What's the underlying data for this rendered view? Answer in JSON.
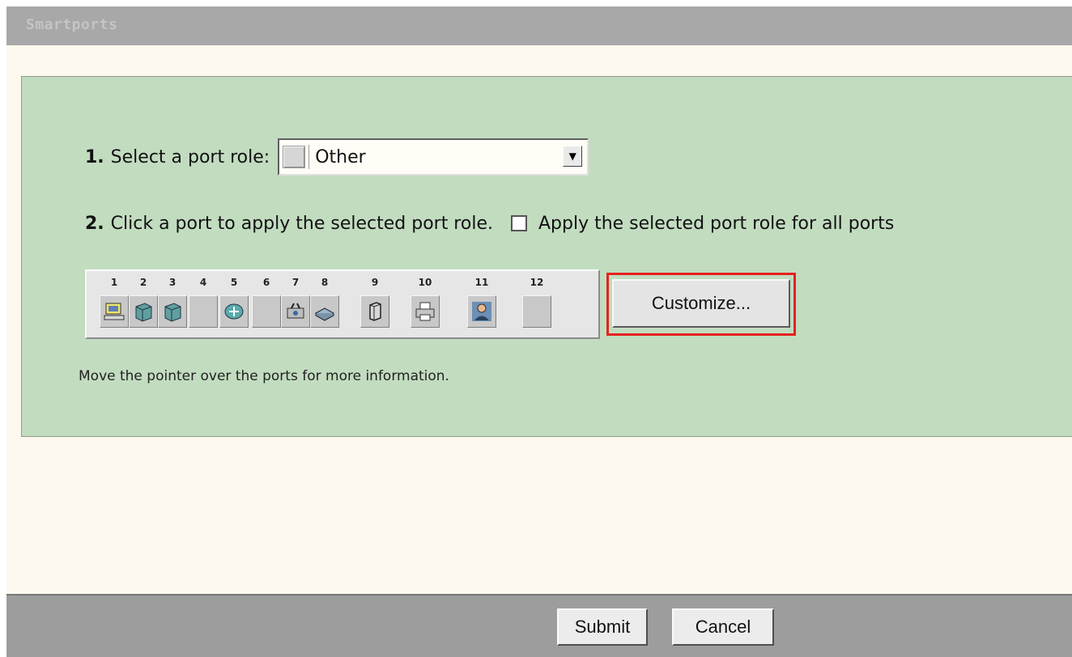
{
  "window": {
    "title": "Smartports"
  },
  "step1": {
    "number": "1.",
    "label": "Select a port role:",
    "selected_value": "Other"
  },
  "step2": {
    "number": "2.",
    "label": "Click a port to apply the selected port role.",
    "apply_all_label": "Apply the selected port role for all ports",
    "apply_all_checked": false
  },
  "ports": [
    {
      "label": "1",
      "icon": "desktop-icon"
    },
    {
      "label": "2",
      "icon": "switch-icon"
    },
    {
      "label": "3",
      "icon": "switch-icon"
    },
    {
      "label": "4",
      "icon": "empty-icon"
    },
    {
      "label": "5",
      "icon": "router-icon"
    },
    {
      "label": "6",
      "icon": "empty-icon"
    },
    {
      "label": "7",
      "icon": "access-point-icon"
    },
    {
      "label": "8",
      "icon": "hub-icon"
    },
    {
      "label": "9",
      "icon": "server-icon"
    },
    {
      "label": "10",
      "icon": "printer-icon"
    },
    {
      "label": "11",
      "icon": "user-icon"
    },
    {
      "label": "12",
      "icon": "empty-icon"
    }
  ],
  "customize_label": "Customize...",
  "hint": "Move the pointer over the ports for more information.",
  "footer": {
    "submit_label": "Submit",
    "cancel_label": "Cancel"
  },
  "colors": {
    "panel": "#c2dcc0",
    "titlebar": "#a8a8a8",
    "highlight": "#e4221f",
    "page": "#fdf9ef"
  }
}
